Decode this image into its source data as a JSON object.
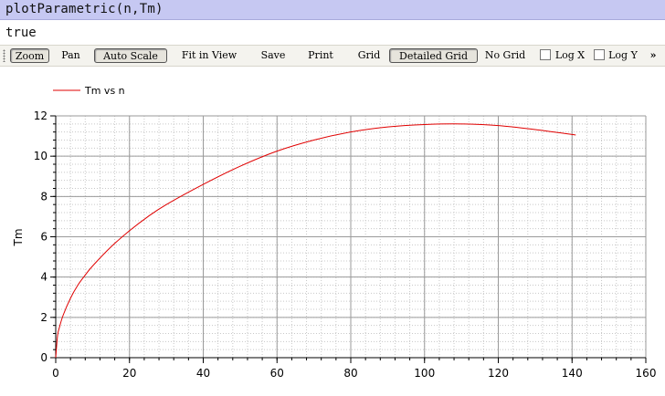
{
  "command": {
    "text": "plotParametric(n,Tm)"
  },
  "result": {
    "text": "true"
  },
  "toolbar": {
    "zoom": "Zoom",
    "pan": "Pan",
    "auto_scale": "Auto Scale",
    "fit_in_view": "Fit in View",
    "save": "Save",
    "print": "Print",
    "grid": "Grid",
    "detailed_grid": "Detailed Grid",
    "no_grid": "No Grid",
    "log_x": "Log X",
    "log_y": "Log Y",
    "overflow": "»",
    "log_x_checked": false,
    "log_y_checked": false
  },
  "chart_data": {
    "type": "line",
    "title": "",
    "xlabel": "",
    "ylabel": "Tm",
    "xlim": [
      0,
      160
    ],
    "ylim": [
      0,
      12
    ],
    "xticks": [
      0,
      20,
      40,
      60,
      80,
      100,
      120,
      140,
      160
    ],
    "yticks": [
      0,
      2,
      4,
      6,
      8,
      10,
      12
    ],
    "grid": "detailed",
    "legend_position": "top-left",
    "series": [
      {
        "name": "Tm vs n",
        "color": "#e00000",
        "x": [
          0,
          0.5,
          1,
          2,
          4,
          6,
          8,
          10,
          15,
          20,
          25,
          30,
          40,
          50,
          60,
          70,
          80,
          90,
          100,
          110,
          120,
          130,
          141
        ],
        "y": [
          0,
          1.1,
          1.5,
          2.1,
          2.95,
          3.6,
          4.1,
          4.55,
          5.5,
          6.3,
          7.0,
          7.6,
          8.6,
          9.5,
          10.25,
          10.8,
          11.2,
          11.45,
          11.57,
          11.6,
          11.52,
          11.32,
          11.05
        ]
      }
    ]
  }
}
